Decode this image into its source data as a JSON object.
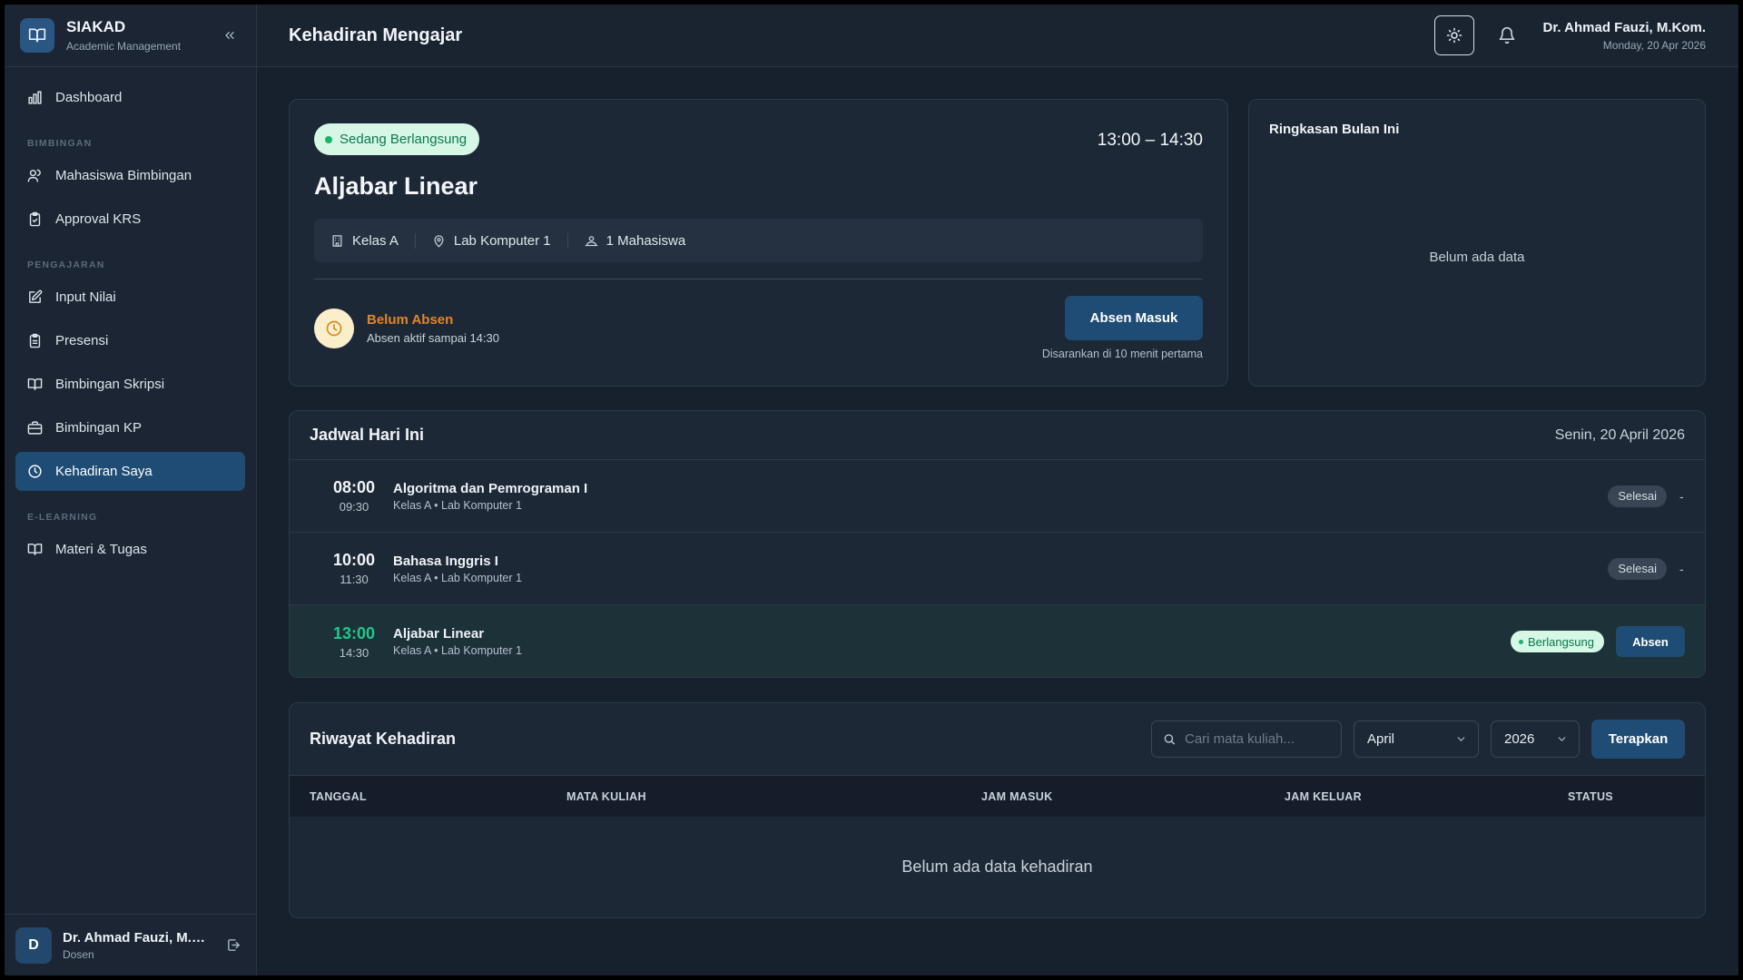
{
  "brand": {
    "title": "SIAKAD",
    "subtitle": "Academic Management"
  },
  "nav": {
    "dashboard": "Dashboard",
    "section_bimbingan": "BIMBINGAN",
    "mahasiswa_bimbingan": "Mahasiswa Bimbingan",
    "approval_krs": "Approval KRS",
    "section_pengajaran": "PENGAJARAN",
    "input_nilai": "Input Nilai",
    "presensi": "Presensi",
    "bimbingan_skripsi": "Bimbingan Skripsi",
    "bimbingan_kp": "Bimbingan KP",
    "kehadiran_saya": "Kehadiran Saya",
    "section_elearning": "E-LEARNING",
    "materi_tugas": "Materi & Tugas"
  },
  "footer": {
    "avatar": "D",
    "name": "Dr. Ahmad Fauzi, M.Kom.",
    "role": "Dosen"
  },
  "header": {
    "title": "Kehadiran Mengajar",
    "user_name": "Dr. Ahmad Fauzi, M.Kom.",
    "user_date": "Monday, 20 Apr 2026"
  },
  "current": {
    "badge": "Sedang Berlangsung",
    "time_range": "13:00 – 14:30",
    "course": "Aljabar Linear",
    "class": "Kelas A",
    "room": "Lab Komputer 1",
    "students": "1 Mahasiswa",
    "status": "Belum Absen",
    "status_note": "Absen aktif sampai 14:30",
    "button": "Absen Masuk",
    "hint": "Disarankan di 10 menit pertama"
  },
  "summary": {
    "title": "Ringkasan Bulan Ini",
    "empty": "Belum ada data"
  },
  "schedule": {
    "title": "Jadwal Hari Ini",
    "date": "Senin, 20 April 2026",
    "rows": [
      {
        "start": "08:00",
        "end": "09:30",
        "name": "Algoritma dan Pemrograman I",
        "loc": "Kelas A • Lab Komputer 1",
        "status": "Selesai",
        "action": "-"
      },
      {
        "start": "10:00",
        "end": "11:30",
        "name": "Bahasa Inggris I",
        "loc": "Kelas A • Lab Komputer 1",
        "status": "Selesai",
        "action": "-"
      },
      {
        "start": "13:00",
        "end": "14:30",
        "name": "Aljabar Linear",
        "loc": "Kelas A • Lab Komputer 1",
        "status": "Berlangsung",
        "action": "Absen"
      }
    ]
  },
  "history": {
    "title": "Riwayat Kehadiran",
    "search_placeholder": "Cari mata kuliah...",
    "month": "April",
    "year": "2026",
    "apply": "Terapkan",
    "columns": [
      "TANGGAL",
      "MATA KULIAH",
      "JAM MASUK",
      "JAM KELUAR",
      "STATUS"
    ],
    "empty": "Belum ada data kehadiran"
  },
  "colors": {
    "accent": "#1f4c74",
    "success": "#19b36b",
    "warning": "#e2852a",
    "background": "#17212e"
  }
}
